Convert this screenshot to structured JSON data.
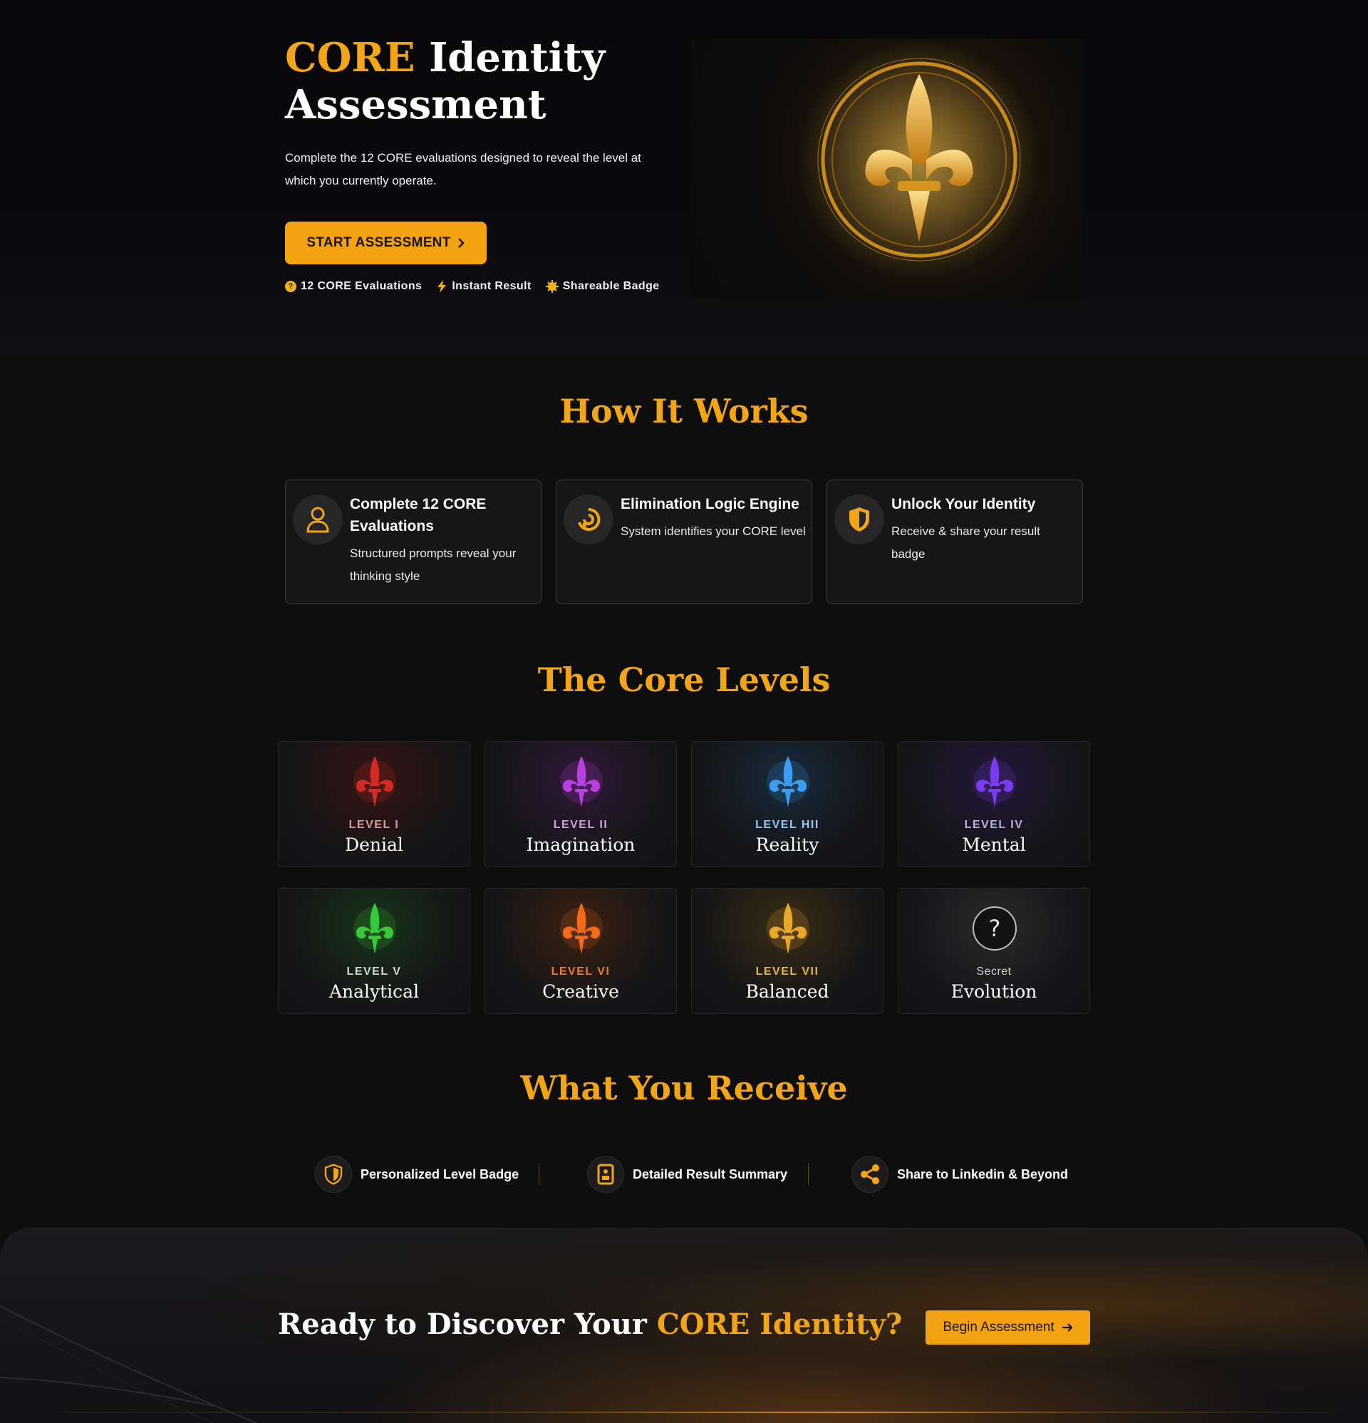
{
  "hero": {
    "title_accent": "CORE",
    "title_rest_line1": "Identity",
    "title_line2": "Assessment",
    "description": "Complete the 12 CORE evaluations designed to reveal the level at which you currently operate.",
    "cta_label": "START ASSESSMENT",
    "features": [
      {
        "icon": "question-icon",
        "label": "12 CORE Evaluations"
      },
      {
        "icon": "lightning-icon",
        "label": "Instant Result"
      },
      {
        "icon": "badge-icon",
        "label": "Shareable Badge"
      }
    ]
  },
  "how_it_works": {
    "title": "How It Works",
    "cards": [
      {
        "icon": "user-icon",
        "title": "Complete 12 CORE Evaluations",
        "desc": "Structured prompts reveal your thinking style"
      },
      {
        "icon": "refresh-icon",
        "title": "Elimination Logic Engine",
        "desc": "System identifies your CORE level"
      },
      {
        "icon": "shield-icon",
        "title": "Unlock Your Identity",
        "desc": "Receive & share your result badge"
      }
    ]
  },
  "core_levels": {
    "title": "The Core Levels",
    "levels": [
      {
        "tag": "LEVEL I",
        "name": "Denial",
        "color": "#d42a24"
      },
      {
        "tag": "LEVEL II",
        "name": "Imagination",
        "color": "#b840e0"
      },
      {
        "tag": "LEVEL HII",
        "name": "Reality",
        "color": "#3e9cf0"
      },
      {
        "tag": "LEVEL IV",
        "name": "Mental",
        "color": "#7a3cf0"
      },
      {
        "tag": "LEVEL V",
        "name": "Analytical",
        "color": "#38c93a"
      },
      {
        "tag": "LEVEL VI",
        "name": "Creative",
        "color": "#f06a18"
      },
      {
        "tag": "LEVEL VII",
        "name": "Balanced",
        "color": "#e8a828"
      },
      {
        "tag": "Secret",
        "name": "Evolution",
        "color": "#9a9a9a"
      }
    ]
  },
  "receive": {
    "title": "What You Receive",
    "items": [
      {
        "icon": "shield-icon",
        "label": "Personalized Level Badge"
      },
      {
        "icon": "document-icon",
        "label": "Detailed Result Summary"
      },
      {
        "icon": "share-icon",
        "label": "Share to Linkedin & Beyond"
      }
    ]
  },
  "cta": {
    "title_prefix": "Ready to Discover Your",
    "title_accent": "CORE Identity?",
    "button_label": "Begin Assessment"
  },
  "colors": {
    "accent": "#f2a516",
    "background": "#0e0e0f"
  }
}
